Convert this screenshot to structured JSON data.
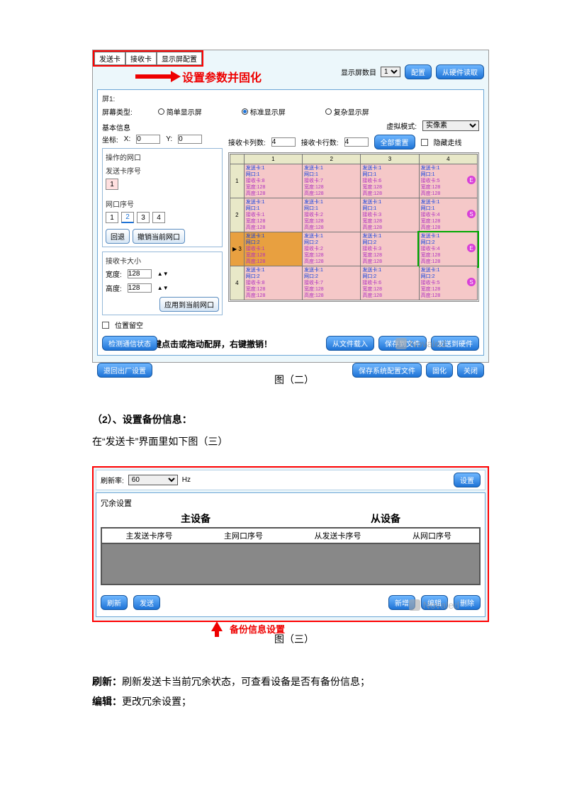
{
  "fig1": {
    "tabs": {
      "send": "发送卡",
      "recv": "接收卡",
      "screen": "显示屏配置"
    },
    "arrow_text": "设置参数并固化",
    "top_right": {
      "label": "显示屏数目",
      "value": "1",
      "btn_config": "配置",
      "btn_read": "从硬件读取"
    },
    "screen_label": "屏1:",
    "screen_type_label": "屏幕类型:",
    "radios": {
      "simple": "简单显示屏",
      "standard": "标准显示屏",
      "complex": "复杂显示屏"
    },
    "basic_info": "基本信息",
    "coord_label": "坐标:",
    "x": "X:",
    "x_val": "0",
    "y": "Y:",
    "y_val": "0",
    "virtual_label": "虚拟模式:",
    "virtual_val": "实像素",
    "op_port": "操作的网口",
    "send_card_seq": "发送卡序号",
    "send_card_num": "1",
    "port_seq": "网口序号",
    "ports": [
      "1",
      "2",
      "3",
      "4"
    ],
    "btn_back": "回退",
    "btn_clear_port": "撤销当前网口",
    "recv_size": "接收卡大小",
    "width": "宽度:",
    "width_val": "128",
    "height": "高度:",
    "height_val": "128",
    "btn_apply_port": "应用到当前网口",
    "chk_pos": "位置留空",
    "grid": {
      "cols_label": "接收卡列数:",
      "cols": "4",
      "rows_label": "接收卡行数:",
      "rows": "4",
      "btn_reset": "全部重置",
      "chk_hide": "隐藏走线",
      "cell": {
        "send": "发送卡:1",
        "port": "网口:",
        "recv": "接收卡:",
        "w": "宽度:128",
        "h": "高度:128"
      }
    },
    "hint": "提示：鼠标左键点击或拖动配屏，右键撤销！",
    "bottom": {
      "check": "检测通信状态",
      "load": "从文件载入",
      "save": "保存到文件",
      "send": "发送到硬件"
    },
    "footer": {
      "back_factory": "退回出厂设置",
      "save_sys": "保存系统配置文件",
      "solid": "固化",
      "close": "关闭"
    },
    "watermark": "Novaled"
  },
  "caption1": "图（二）",
  "section": {
    "heading": "（2）、设置备份信息：",
    "line": "在“发送卡”界面里如下图（三）"
  },
  "fig2": {
    "top": {
      "refresh_label": "刷新率:",
      "refresh_val": "60",
      "hz": "Hz",
      "btn_set": "设置"
    },
    "panel_title": "冗余设置",
    "main_dev": "主设备",
    "slave_dev": "从设备",
    "cols": {
      "c1": "主发送卡序号",
      "c2": "主网口序号",
      "c3": "从发送卡序号",
      "c4": "从网口序号"
    },
    "btns": {
      "refresh": "刷新",
      "send": "发送",
      "add": "新增",
      "edit": "编辑",
      "del": "删除"
    },
    "arrow_note": "备份信息设置",
    "watermark": "Novaled"
  },
  "caption2": "图（三）",
  "desc": {
    "refresh_label": "刷新：",
    "refresh_text": "刷新发送卡当前冗余状态，可查看设备是否有备份信息；",
    "edit_label": "编辑：",
    "edit_text": "更改冗余设置；"
  }
}
